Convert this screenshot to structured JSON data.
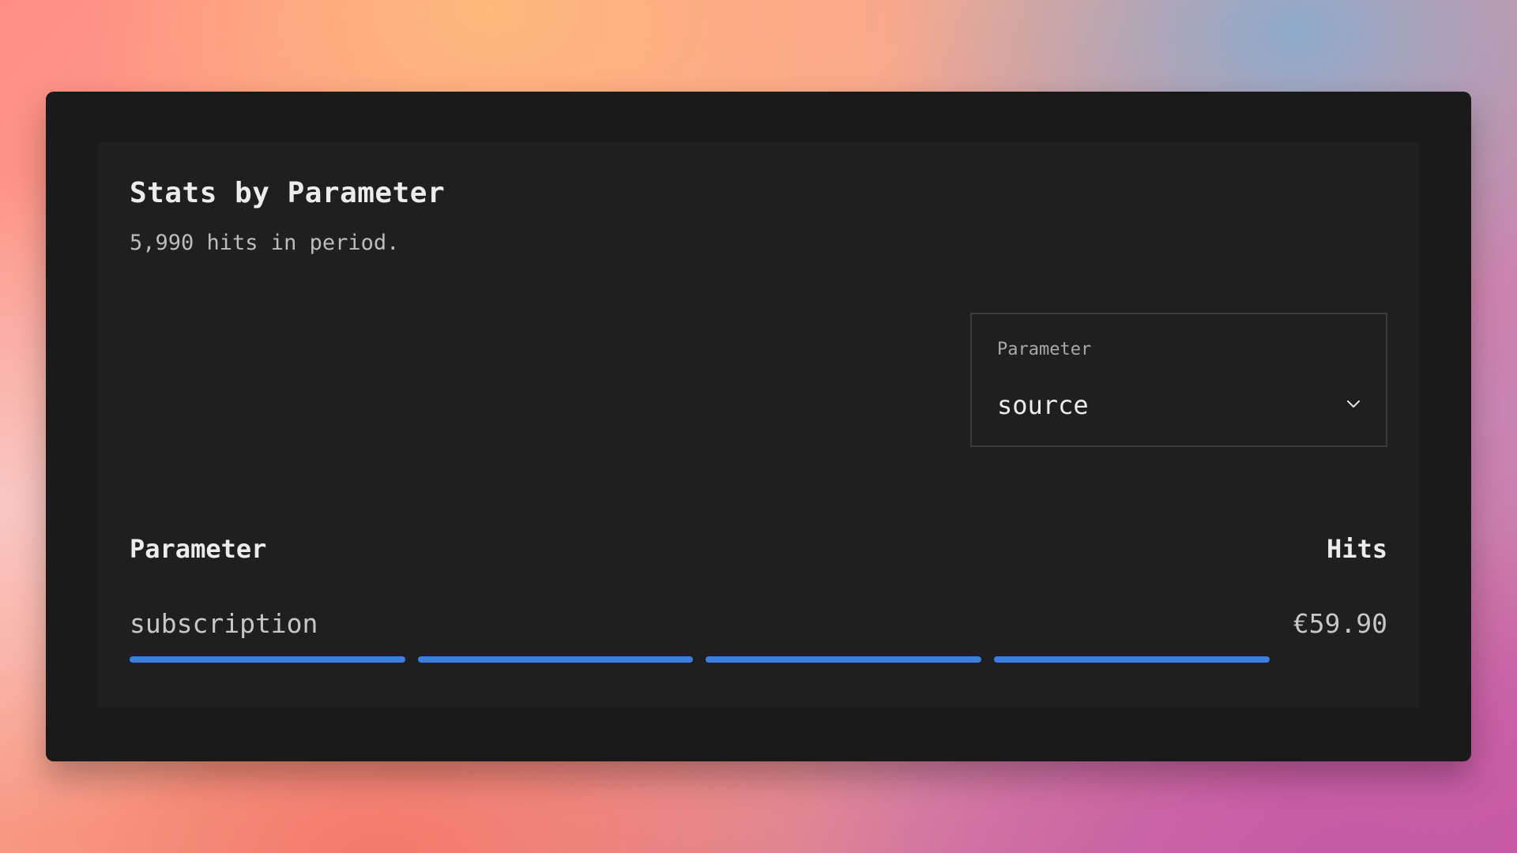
{
  "card": {
    "title": "Stats by Parameter",
    "subtitle": "5,990 hits in period."
  },
  "parameter_select": {
    "label": "Parameter",
    "value": "source",
    "icon": "chevron-down-icon"
  },
  "table": {
    "columns": [
      "Parameter",
      "Hits"
    ],
    "rows": [
      {
        "parameter": "subscription",
        "hits": "€59.90",
        "bar_segments": 4,
        "bar_fraction": 0.953
      }
    ]
  },
  "colors": {
    "bar": "#3a7ee6",
    "panel": "#1f1f1f",
    "window": "#1a1a1a"
  }
}
